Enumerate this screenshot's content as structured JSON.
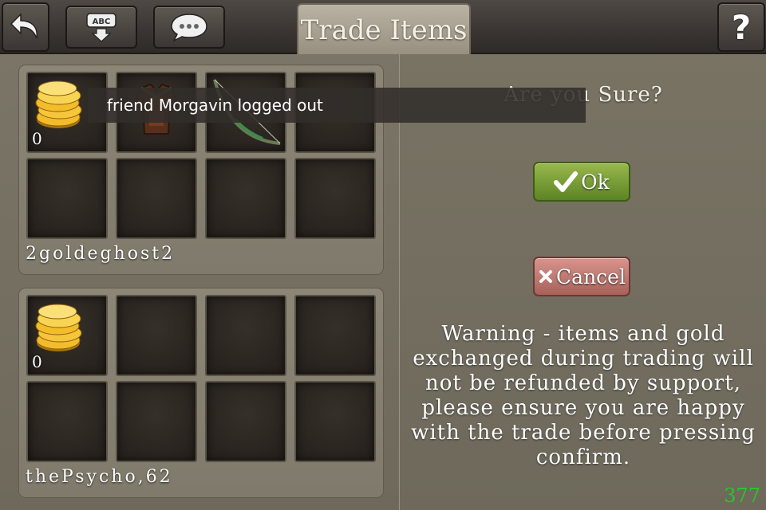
{
  "header": {
    "back_icon": "back-arrow-icon",
    "keyboard_icon": "keyboard-abc-icon",
    "keyboard_label": "ABC",
    "chat_icon": "chat-bubble-icon",
    "tab_title": "Trade Items",
    "help_label": "?"
  },
  "trade": {
    "players": [
      {
        "name": "2goldeghost2",
        "gold_qty": "0",
        "items": [
          "gold-coins-icon",
          "armor-icon",
          "bow-icon"
        ]
      },
      {
        "name": "thePsycho,62",
        "gold_qty": "0",
        "items": [
          "gold-coins-icon"
        ]
      }
    ]
  },
  "confirm": {
    "question": "Are you Sure?",
    "ok_label": "Ok",
    "cancel_label": "Cancel",
    "warning": "Warning - items and gold exchanged during trading will not be refunded by support, please ensure you are happy with the trade before pressing confirm.",
    "counter": "377"
  },
  "notification": {
    "text": "friend Morgavin logged out"
  },
  "colors": {
    "ok": "#6f9a2e",
    "cancel": "#b86c64",
    "counter": "#29c629"
  }
}
